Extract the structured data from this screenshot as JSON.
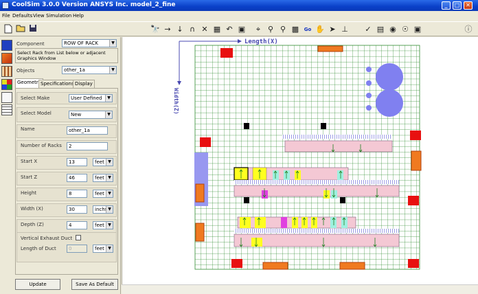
{
  "window": {
    "title": "CoolSim 3.0.0 Version ANSYS Inc.   model_2_fine",
    "minimize": "_",
    "maximize": "□",
    "close": "✕"
  },
  "menu": [
    "File",
    "Defaults",
    "View",
    "Simulation",
    "Help"
  ],
  "toolbar": {
    "left_icons": [
      "new-file-icon",
      "open-folder-icon",
      "save-icon"
    ],
    "right_icons": [
      "binoculars-icon",
      "arrow-right-icon",
      "arrow-down-icon",
      "magnet-icon",
      "delete-icon",
      "grid-icon",
      "undo-icon",
      "screen-icon",
      "zoom-fit-icon",
      "zoom-in-icon",
      "zoom-out-icon",
      "zoom-window-icon",
      "go-icon",
      "pan-hand-icon",
      "pointer-icon",
      "axes-icon",
      "check-icon",
      "chart-icon",
      "find-icon",
      "eye-icon",
      "layers-icon",
      "info-icon"
    ],
    "go_label": "Go"
  },
  "panel": {
    "component_label": "Component",
    "component_value": "ROW OF RACK",
    "info_text": "Select Rack from List below or adjacent Graphics Window",
    "objects_label": "Objects",
    "objects_value": "other_1a",
    "tabs": [
      "Geometry",
      "Specifications",
      "Display"
    ],
    "fields": {
      "select_make_label": "Select Make",
      "select_make_value": "User Defined",
      "select_model_label": "Select Model",
      "select_model_value": "New",
      "name_label": "Name",
      "name_value": "other_1a",
      "num_racks_label": "Number of Racks",
      "num_racks_value": "2",
      "start_x_label": "Start X",
      "start_x_value": "13",
      "start_x_unit": "feet",
      "start_z_label": "Start Z",
      "start_z_value": "46",
      "start_z_unit": "feet",
      "height_label": "Height",
      "height_value": "8",
      "height_unit": "feet",
      "width_label": "Width (X)",
      "width_value": "30",
      "width_unit": "inchs",
      "depth_label": "Depth (Z)",
      "depth_value": "4",
      "depth_unit": "feet",
      "vertical_duct_label": "Vertical Exhaust Duct",
      "length_duct_label": "Length of Duct",
      "length_duct_value": "0",
      "length_duct_unit": "feet"
    },
    "update_button": "Update",
    "save_default_button": "Save As Default"
  },
  "side_tools": [
    "rack-tool-icon",
    "crac-tool-icon",
    "door-tool-icon",
    "tile-tool-icon",
    "wall-tool-icon",
    "grid-tool-icon"
  ],
  "canvas": {
    "x_axis_label": "Length(X)",
    "z_axis_label": "Width(Z)",
    "colors": {
      "grid": "#2e8b2e",
      "crac_red": "#e81010",
      "crac_orange": "#f07a20",
      "rack_pink": "#f4c8d4",
      "rack_yellow": "#ffff20",
      "tile_blue": "#9898f0",
      "rack_magenta": "#e040e0",
      "rack_cyan": "#9ff0e0",
      "duct_blue": "#3838c8",
      "black_obj": "#000000"
    }
  }
}
